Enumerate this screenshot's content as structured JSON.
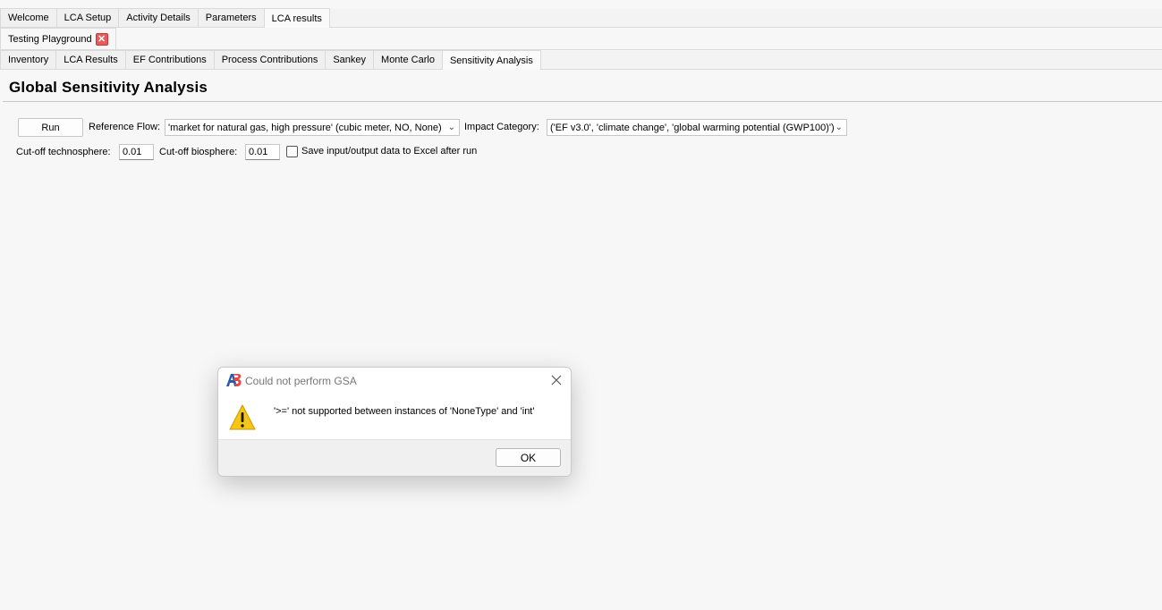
{
  "main_tabs": [
    "Welcome",
    "LCA Setup",
    "Activity Details",
    "Parameters",
    "LCA results"
  ],
  "main_active": "LCA results",
  "calc_tab": {
    "label": "Testing Playground",
    "close": "✕"
  },
  "sub_tabs": [
    "Inventory",
    "LCA Results",
    "EF Contributions",
    "Process Contributions",
    "Sankey",
    "Monte Carlo",
    "Sensitivity Analysis"
  ],
  "sub_active": "Sensitivity Analysis",
  "page": {
    "title": "Global Sensitivity Analysis"
  },
  "controls": {
    "run_label": "Run",
    "reference_flow_label": "Reference Flow:",
    "reference_flow_value": "'market for natural gas, high pressure' (cubic meter, NO, None)",
    "impact_category_label": "Impact Category:",
    "impact_category_value": "('EF v3.0', 'climate change', 'global warming potential (GWP100)')",
    "cutoff_techno_label": "Cut-off technosphere:",
    "cutoff_techno_value": "0.01",
    "cutoff_bio_label": "Cut-off biosphere:",
    "cutoff_bio_value": "0.01",
    "save_excel_label": "Save input/output data to Excel after run",
    "save_excel_checked": false
  },
  "dialog": {
    "title": "Could not perform GSA",
    "message": "'>=' not supported between instances of 'NoneType' and 'int'",
    "ok_label": "OK",
    "icons": [
      "ab-logo-icon",
      "warning-icon",
      "close-icon"
    ]
  },
  "colors": {
    "accent_red": "#e04a4a",
    "logo_blue": "#2d5aa8",
    "warning_yellow": "#f5c518"
  }
}
